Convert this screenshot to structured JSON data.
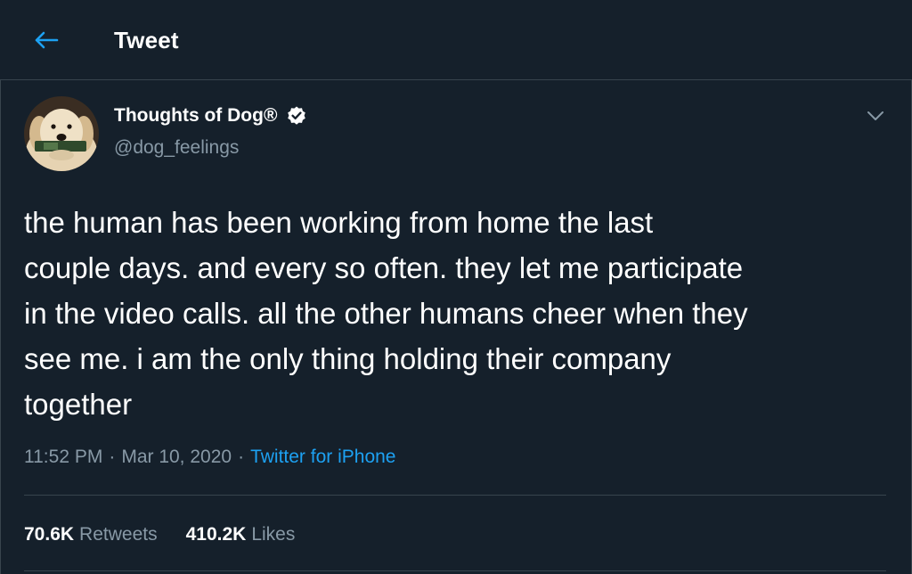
{
  "header": {
    "title": "Tweet",
    "back_icon": "arrow-left-icon"
  },
  "colors": {
    "background": "#15202b",
    "accent": "#1da1f2",
    "secondary_text": "#8899a6",
    "border": "#38444d"
  },
  "tweet": {
    "author": {
      "name": "Thoughts of Dog®",
      "handle": "@dog_feelings",
      "verified": true,
      "avatar_icon": "dog-avatar"
    },
    "text": "the human has been working from home the last\ncouple days. and every so often. they let me participate\nin the video calls. all the other humans cheer when they\nsee me. i am the only thing holding their company\ntogether",
    "time": "11:52 PM",
    "date": "Mar 10, 2020",
    "separator": "·",
    "source": "Twitter for iPhone",
    "retweets": {
      "count": "70.6K",
      "label": "Retweets"
    },
    "likes": {
      "count": "410.2K",
      "label": "Likes"
    }
  }
}
